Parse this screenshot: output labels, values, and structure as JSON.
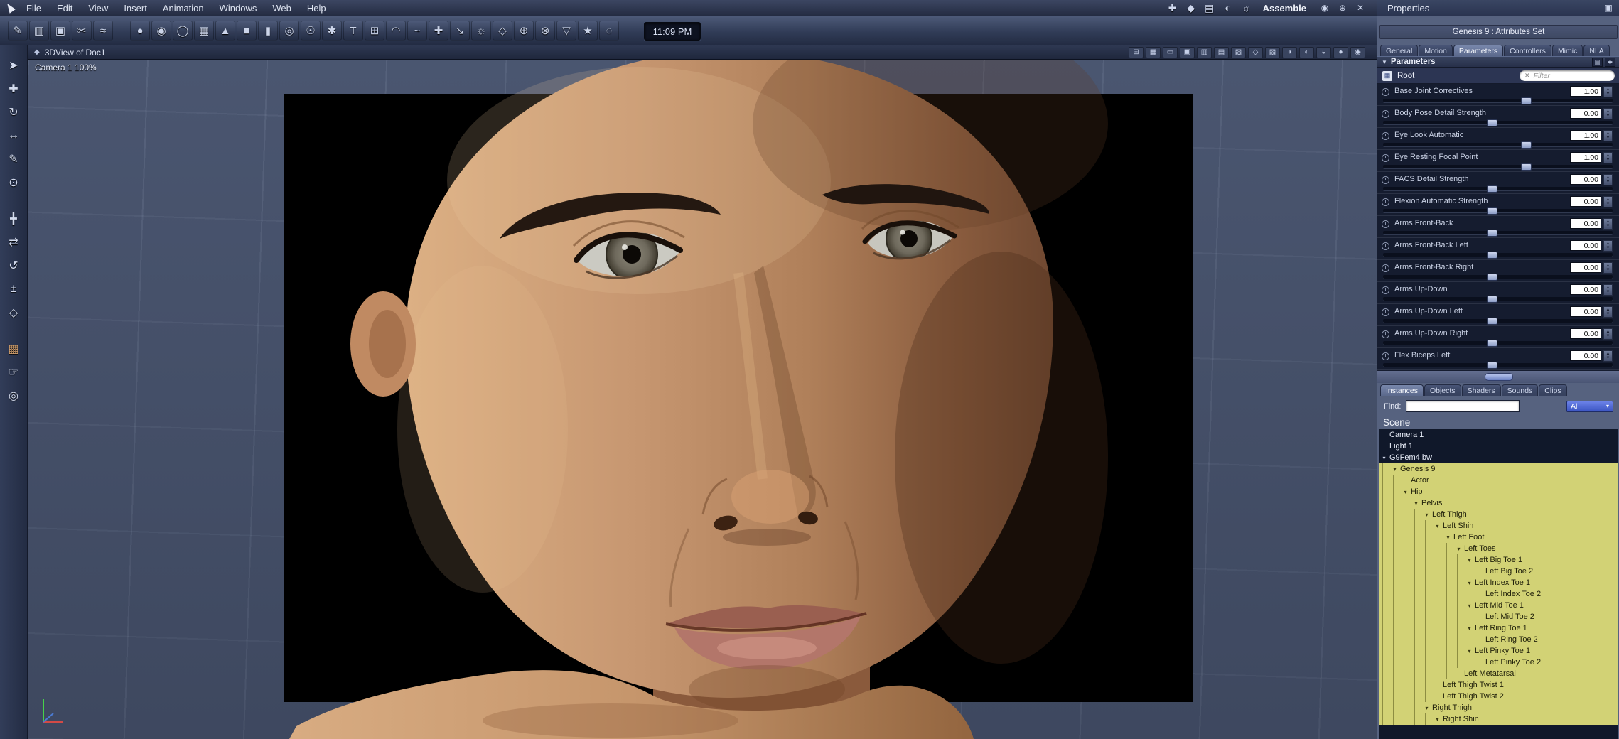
{
  "colors": {
    "selection_yellow": "#d2d275",
    "panel_bg": "#56627f",
    "viewport_bg": "#4e5a75",
    "accent_blue": "#4e63d0",
    "skin_base": "#c08e66",
    "chrome_dark": "#232c43"
  },
  "glyphs": {
    "up": "▲",
    "down": "▼",
    "expand": "▾",
    "dropdown": "▾",
    "close": "✕",
    "collapse": "▼"
  },
  "menu_bar": {
    "items": [
      "File",
      "Edit",
      "View",
      "Insert",
      "Animation",
      "Windows",
      "Web",
      "Help"
    ],
    "room_icons": [
      {
        "name": "room-assemble-icon",
        "glyph": "✚"
      },
      {
        "name": "room-model-icon",
        "glyph": "◆"
      },
      {
        "name": "room-storyboard-icon",
        "glyph": "▤"
      },
      {
        "name": "room-texture-icon",
        "glyph": "◐"
      },
      {
        "name": "room-render-icon",
        "glyph": "☼"
      }
    ],
    "mode_label": "Assemble",
    "view_icons": [
      {
        "name": "eye-icon",
        "glyph": "◉"
      },
      {
        "name": "target-icon",
        "glyph": "⊕"
      },
      {
        "name": "close-icon",
        "glyph": "✕"
      }
    ]
  },
  "toolbar": {
    "time": "11:09 PM",
    "left_group": [
      {
        "name": "paint-tool-icon",
        "glyph": "✎"
      },
      {
        "name": "roller-tool-icon",
        "glyph": "▥"
      },
      {
        "name": "fill-tool-icon",
        "glyph": "▣"
      },
      {
        "name": "scissors-tool-icon",
        "glyph": "✂"
      },
      {
        "name": "smooth-tool-icon",
        "glyph": "≈"
      }
    ],
    "main_group": [
      {
        "name": "sphere-primitive-icon",
        "glyph": "●"
      },
      {
        "name": "vertex-object-icon",
        "glyph": "◉"
      },
      {
        "name": "spline-object-icon",
        "glyph": "◯"
      },
      {
        "name": "grid-plane-icon",
        "glyph": "▦"
      },
      {
        "name": "cone-primitive-icon",
        "glyph": "▲"
      },
      {
        "name": "cube-primitive-icon",
        "glyph": "■"
      },
      {
        "name": "cylinder-primitive-icon",
        "glyph": "▮"
      },
      {
        "name": "torus-primitive-icon",
        "glyph": "◎"
      },
      {
        "name": "metaball-icon",
        "glyph": "☉"
      },
      {
        "name": "particles-icon",
        "glyph": "✱"
      },
      {
        "name": "text-object-icon",
        "glyph": "T"
      },
      {
        "name": "duplicate-icon",
        "glyph": "⊞"
      },
      {
        "name": "arc-tool-icon",
        "glyph": "◠"
      },
      {
        "name": "wave-tool-icon",
        "glyph": "~"
      },
      {
        "name": "add-object-icon",
        "glyph": "✚"
      },
      {
        "name": "offset-icon",
        "glyph": "↘"
      },
      {
        "name": "light-icon",
        "glyph": "☼"
      },
      {
        "name": "camera-object-icon",
        "glyph": "◇"
      },
      {
        "name": "boolean-icon",
        "glyph": "⊕"
      },
      {
        "name": "blend-icon",
        "glyph": "⊗"
      },
      {
        "name": "funnel-icon",
        "glyph": "▽"
      },
      {
        "name": "star-icon",
        "glyph": "★"
      },
      {
        "name": "measure-icon",
        "glyph": "◌"
      }
    ]
  },
  "left_toolbar": {
    "icons": [
      {
        "name": "select-tool-icon",
        "glyph": "➤"
      },
      {
        "name": "move-tool-icon",
        "glyph": "✚"
      },
      {
        "name": "rotate-tool-icon",
        "glyph": "↻"
      },
      {
        "name": "scale-tool-icon",
        "glyph": "↔"
      },
      {
        "name": "knife-tool-icon",
        "glyph": "✎"
      },
      {
        "name": "target-helper-icon",
        "glyph": "⊙"
      },
      {
        "name": "translate-xyz-icon",
        "glyph": "╋",
        "gap_before": true
      },
      {
        "name": "axis-move-icon",
        "glyph": "⇄"
      },
      {
        "name": "axis-rotate-icon",
        "glyph": "↺"
      },
      {
        "name": "axis-scale-icon",
        "glyph": "±"
      },
      {
        "name": "hotpoint-icon",
        "glyph": "◇"
      },
      {
        "name": "display-box-icon",
        "glyph": "▩",
        "gap_before": true,
        "tan": true
      },
      {
        "name": "pan-tool-icon",
        "glyph": "☞"
      },
      {
        "name": "zoom-tool-icon",
        "glyph": "◎"
      }
    ]
  },
  "viewport": {
    "title": "3DView of Doc1",
    "camera_label": "Camera 1 100%",
    "title_icon": "◆",
    "right_icons": [
      {
        "name": "magnet-snap-icon",
        "glyph": "⊞"
      },
      {
        "name": "grid-toggle-icon",
        "glyph": "▦"
      },
      {
        "name": "ruler-icon",
        "glyph": "▭"
      },
      {
        "name": "layout-single-icon",
        "glyph": "▣"
      },
      {
        "name": "layout-columns-icon",
        "glyph": "▥"
      },
      {
        "name": "layout-rows-icon",
        "glyph": "▤"
      },
      {
        "name": "layout-quad-icon",
        "glyph": "▧"
      },
      {
        "name": "camera-lock-icon",
        "glyph": "◇"
      },
      {
        "name": "presets-icon",
        "glyph": "▨"
      },
      {
        "name": "shading-flat-icon",
        "glyph": "◑"
      },
      {
        "name": "shading-gouraud-icon",
        "glyph": "◐"
      },
      {
        "name": "shading-textured-icon",
        "glyph": "◒"
      },
      {
        "name": "preview-sphere-icon",
        "glyph": "●"
      },
      {
        "name": "options-sphere-icon",
        "glyph": "◉"
      }
    ]
  },
  "properties": {
    "title": "Properties",
    "corner_icon": "▣",
    "subtitle": "Genesis 9 : Attributes Set",
    "tabs": [
      {
        "label": "General",
        "name": "tab-general"
      },
      {
        "label": "Motion",
        "name": "tab-motion"
      },
      {
        "label": "Parameters",
        "name": "tab-parameters"
      },
      {
        "label": "Controllers",
        "name": "tab-controllers"
      },
      {
        "label": "Mimic",
        "name": "tab-mimic"
      },
      {
        "label": "NLA",
        "name": "tab-nla"
      }
    ],
    "active_tab": "Parameters",
    "section_label": "Parameters",
    "header_icons": [
      {
        "name": "param-list-options-icon",
        "glyph": "▤"
      },
      {
        "name": "param-add-icon",
        "glyph": "✚"
      }
    ],
    "root": {
      "icon_glyph": "▦",
      "label": "Root",
      "filter_placeholder": "Filter"
    },
    "params": [
      {
        "label": "Base Joint Correctives",
        "value": "1.00",
        "slider_pct": 62
      },
      {
        "label": "Body Pose Detail Strength",
        "value": "0.00",
        "slider_pct": 47
      },
      {
        "label": "Eye Look Automatic",
        "value": "1.00",
        "slider_pct": 62
      },
      {
        "label": "Eye Resting Focal Point",
        "value": "1.00",
        "slider_pct": 62
      },
      {
        "label": "FACS Detail Strength",
        "value": "0.00",
        "slider_pct": 47
      },
      {
        "label": "Flexion Automatic Strength",
        "value": "0.00",
        "slider_pct": 47
      },
      {
        "label": "Arms Front-Back",
        "value": "0.00",
        "slider_pct": 47
      },
      {
        "label": "Arms Front-Back Left",
        "value": "0.00",
        "slider_pct": 47
      },
      {
        "label": "Arms Front-Back Right",
        "value": "0.00",
        "slider_pct": 47
      },
      {
        "label": "Arms Up-Down",
        "value": "0.00",
        "slider_pct": 47
      },
      {
        "label": "Arms Up-Down Left",
        "value": "0.00",
        "slider_pct": 47
      },
      {
        "label": "Arms Up-Down Right",
        "value": "0.00",
        "slider_pct": 47
      },
      {
        "label": "Flex Biceps Left",
        "value": "0.00",
        "slider_pct": 47
      }
    ]
  },
  "browser": {
    "tabs": [
      {
        "label": "Instances",
        "name": "tab-instances"
      },
      {
        "label": "Objects",
        "name": "tab-objects"
      },
      {
        "label": "Shaders",
        "name": "tab-shaders"
      },
      {
        "label": "Sounds",
        "name": "tab-sounds"
      },
      {
        "label": "Clips",
        "name": "tab-clips"
      }
    ],
    "active_tab": "Instances",
    "find_label": "Find:",
    "find_value": "",
    "all_value": "All",
    "scene_label": "Scene",
    "tree": [
      {
        "label": "Camera 1",
        "level": 0,
        "expandable": false,
        "selected": false
      },
      {
        "label": "Light 1",
        "level": 0,
        "expandable": false,
        "selected": false
      },
      {
        "label": "G9Fem4 bw",
        "level": 0,
        "expandable": true,
        "selected": false
      },
      {
        "label": "Genesis 9",
        "level": 1,
        "expandable": true,
        "selected": true
      },
      {
        "label": "Actor",
        "level": 2,
        "expandable": false,
        "selected": true
      },
      {
        "label": "Hip",
        "level": 2,
        "expandable": true,
        "selected": true
      },
      {
        "label": "Pelvis",
        "level": 3,
        "expandable": true,
        "selected": true
      },
      {
        "label": "Left Thigh",
        "level": 4,
        "expandable": true,
        "selected": true
      },
      {
        "label": "Left Shin",
        "level": 5,
        "expandable": true,
        "selected": true
      },
      {
        "label": "Left Foot",
        "level": 6,
        "expandable": true,
        "selected": true
      },
      {
        "label": "Left Toes",
        "level": 7,
        "expandable": true,
        "selected": true
      },
      {
        "label": "Left Big Toe 1",
        "level": 8,
        "expandable": true,
        "selected": true
      },
      {
        "label": "Left Big Toe 2",
        "level": 9,
        "expandable": false,
        "selected": true
      },
      {
        "label": "Left Index Toe 1",
        "level": 8,
        "expandable": true,
        "selected": true
      },
      {
        "label": "Left Index Toe 2",
        "level": 9,
        "expandable": false,
        "selected": true
      },
      {
        "label": "Left Mid Toe 1",
        "level": 8,
        "expandable": true,
        "selected": true
      },
      {
        "label": "Left Mid Toe 2",
        "level": 9,
        "expandable": false,
        "selected": true
      },
      {
        "label": "Left Ring Toe 1",
        "level": 8,
        "expandable": true,
        "selected": true
      },
      {
        "label": "Left Ring Toe 2",
        "level": 9,
        "expandable": false,
        "selected": true
      },
      {
        "label": "Left Pinky Toe 1",
        "level": 8,
        "expandable": true,
        "selected": true
      },
      {
        "label": "Left Pinky Toe 2",
        "level": 9,
        "expandable": false,
        "selected": true
      },
      {
        "label": "Left Metatarsal",
        "level": 7,
        "expandable": false,
        "selected": true
      },
      {
        "label": "Left Thigh Twist 1",
        "level": 5,
        "expandable": false,
        "selected": true
      },
      {
        "label": "Left Thigh Twist 2",
        "level": 5,
        "expandable": false,
        "selected": true
      },
      {
        "label": "Right Thigh",
        "level": 4,
        "expandable": true,
        "selected": true
      },
      {
        "label": "Right Shin",
        "level": 5,
        "expandable": true,
        "selected": true
      }
    ]
  }
}
